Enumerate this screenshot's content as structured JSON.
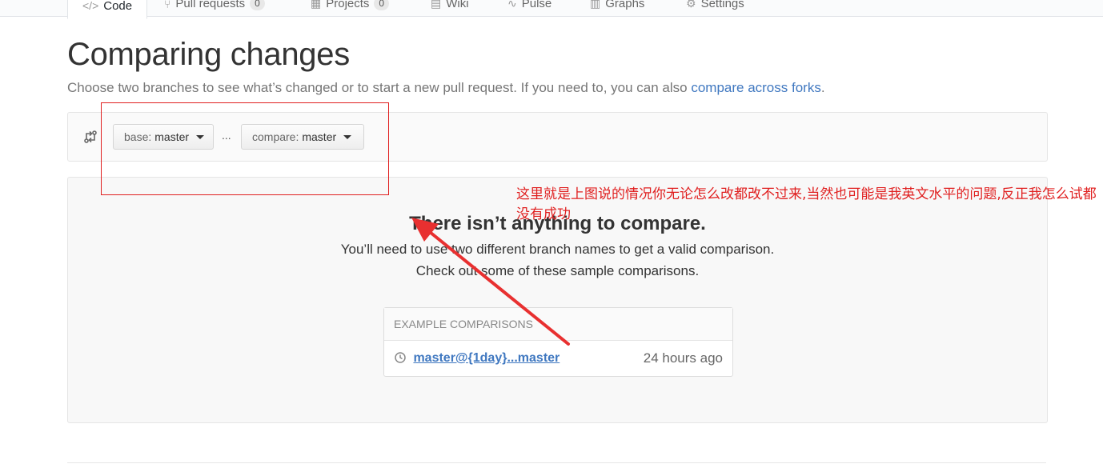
{
  "nav": {
    "tabs": [
      {
        "label": "Code",
        "icon": "code-icon",
        "selected": true
      },
      {
        "label": "Pull requests",
        "count": "0",
        "icon": "git-pull-request-icon"
      },
      {
        "label": "Projects",
        "count": "0",
        "icon": "project-icon"
      },
      {
        "label": "Wiki",
        "icon": "book-icon"
      },
      {
        "label": "Pulse",
        "icon": "pulse-icon"
      },
      {
        "label": "Graphs",
        "icon": "graph-icon"
      },
      {
        "label": "Settings",
        "icon": "gear-icon"
      }
    ]
  },
  "header": {
    "title": "Comparing changes",
    "subtitle_text": "Choose two branches to see what’s changed or to start a new pull request. If you need to, you can also ",
    "subtitle_link": "compare across forks",
    "subtitle_end": "."
  },
  "range": {
    "base_label": "base:",
    "base_branch": "master",
    "separator": "...",
    "compare_label": "compare:",
    "compare_branch": "master"
  },
  "blankslate": {
    "title": "There isn’t anything to compare.",
    "line1": "You’ll need to use two different branch names to get a valid comparison.",
    "line2": "Check out some of these sample comparisons."
  },
  "examples": {
    "header": "EXAMPLE COMPARISONS",
    "rows": [
      {
        "link": "master@{1day}...master",
        "time": "24 hours ago"
      }
    ]
  },
  "annotation": {
    "text": "这里就是上图说的情况你无论怎么改都改不过来,当然也可能是我英文水平的问题,反正我怎么试都没有成功",
    "color": "#e02020"
  },
  "colors": {
    "link": "#4078c0",
    "tab_accent": "#e36209"
  }
}
